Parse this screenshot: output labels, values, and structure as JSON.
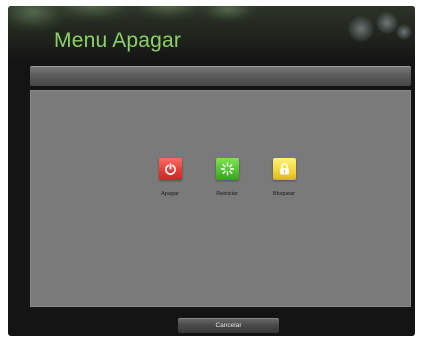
{
  "window": {
    "title": "Menu Apagar"
  },
  "actions": [
    {
      "label": "Apagar",
      "icon": "power-icon",
      "color": "#e23a36"
    },
    {
      "label": "Reiniciar",
      "icon": "restart-icon",
      "color": "#4fc22e"
    },
    {
      "label": "Bloquear",
      "icon": "lock-icon",
      "color": "#f2d53a"
    }
  ],
  "footer": {
    "cancel_label": "Cancelar"
  },
  "colors": {
    "title": "#8ecf6c",
    "panel": "#7a7a7a",
    "background": "#141414"
  }
}
